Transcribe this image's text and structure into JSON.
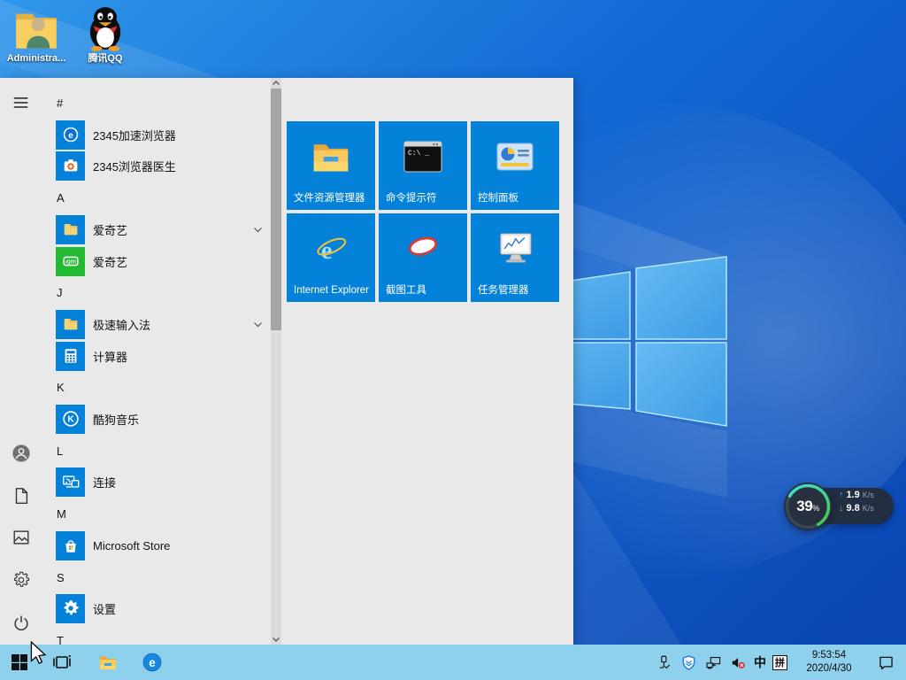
{
  "desktop": {
    "icons": [
      {
        "id": "administrator",
        "label": "Administra...",
        "icon": "admin-folder"
      },
      {
        "id": "tencent-qq",
        "label": "腾讯QQ",
        "icon": "qq-penguin"
      }
    ]
  },
  "start_menu": {
    "rail": {
      "items": [
        {
          "id": "menu",
          "icon": "hamburger"
        },
        {
          "id": "user",
          "icon": "user"
        },
        {
          "id": "documents",
          "icon": "document"
        },
        {
          "id": "pictures",
          "icon": "pictures"
        },
        {
          "id": "settings",
          "icon": "gear-outline"
        },
        {
          "id": "power",
          "icon": "power"
        }
      ]
    },
    "app_list": [
      {
        "type": "header",
        "label": "#"
      },
      {
        "type": "app",
        "id": "2345-speed-browser",
        "label": "2345加速浏览器",
        "icon": "e-circle",
        "tile": "blue"
      },
      {
        "type": "app",
        "id": "2345-browser-doctor",
        "label": "2345浏览器医生",
        "icon": "doctor-case",
        "tile": "blue"
      },
      {
        "type": "header",
        "label": "A"
      },
      {
        "type": "app",
        "id": "iqiyi-folder",
        "label": "爱奇艺",
        "icon": "folder-yellow",
        "tile": "blue",
        "expandable": true
      },
      {
        "type": "app",
        "id": "iqiyi",
        "label": "爱奇艺",
        "icon": "iqiyi",
        "tile": "green"
      },
      {
        "type": "header",
        "label": "J"
      },
      {
        "type": "app",
        "id": "jisu-ime-folder",
        "label": "极速输入法",
        "icon": "folder-yellow",
        "tile": "blue",
        "expandable": true
      },
      {
        "type": "app",
        "id": "calculator",
        "label": "计算器",
        "icon": "calculator",
        "tile": "blue"
      },
      {
        "type": "header",
        "label": "K"
      },
      {
        "type": "app",
        "id": "kugou-music",
        "label": "酷狗音乐",
        "icon": "kugou",
        "tile": "blue"
      },
      {
        "type": "header",
        "label": "L"
      },
      {
        "type": "app",
        "id": "connect",
        "label": "连接",
        "icon": "connect",
        "tile": "blue"
      },
      {
        "type": "header",
        "label": "M"
      },
      {
        "type": "app",
        "id": "microsoft-store",
        "label": "Microsoft Store",
        "icon": "ms-store",
        "tile": "blue"
      },
      {
        "type": "header",
        "label": "S"
      },
      {
        "type": "app",
        "id": "settings",
        "label": "设置",
        "icon": "gear-white",
        "tile": "blue"
      },
      {
        "type": "header",
        "label": "T"
      }
    ],
    "tiles": [
      {
        "id": "file-explorer",
        "label": "文件资源管理器",
        "icon": "tile-file-explorer"
      },
      {
        "id": "command-prompt",
        "label": "命令提示符",
        "icon": "tile-cmd"
      },
      {
        "id": "control-panel",
        "label": "控制面板",
        "icon": "tile-control-panel"
      },
      {
        "id": "internet-explorer",
        "label": "Internet Explorer",
        "icon": "tile-ie"
      },
      {
        "id": "snipping-tool",
        "label": "截图工具",
        "icon": "tile-snipping"
      },
      {
        "id": "task-manager",
        "label": "任务管理器",
        "icon": "tile-taskmgr"
      }
    ]
  },
  "net_widget": {
    "percent": "39",
    "percent_unit": "%",
    "up_value": "1.9",
    "up_unit": "K/s",
    "down_value": "9.8",
    "down_unit": "K/s"
  },
  "taskbar": {
    "buttons": [
      {
        "id": "start",
        "icon": "win-logo"
      },
      {
        "id": "task-view",
        "icon": "task-view"
      },
      {
        "id": "file-explorer",
        "icon": "tb-folder"
      },
      {
        "id": "browser-e",
        "icon": "tb-e"
      }
    ],
    "tray": [
      {
        "id": "usb",
        "icon": "usb"
      },
      {
        "id": "security-shield",
        "icon": "shield"
      },
      {
        "id": "network",
        "icon": "network"
      },
      {
        "id": "volume-muted",
        "icon": "volume-muted"
      },
      {
        "id": "ime-language",
        "label": "中"
      },
      {
        "id": "ime-pinyin",
        "label": "拼",
        "boxed": true
      }
    ],
    "clock": {
      "time": "9:53:54",
      "date": "2020/4/30"
    }
  },
  "colors": {
    "tile_blue": "#0481d9",
    "tile_green": "#22bb33",
    "menu_bg": "#e9e9e9",
    "taskbar_bg": "#8fd0ed",
    "widget_bg": "#232d3d",
    "arc_teal": "#3fe0d0",
    "arc_green": "#46c956",
    "up_arrow": "#4f9df8",
    "down_arrow": "#49c25c"
  }
}
